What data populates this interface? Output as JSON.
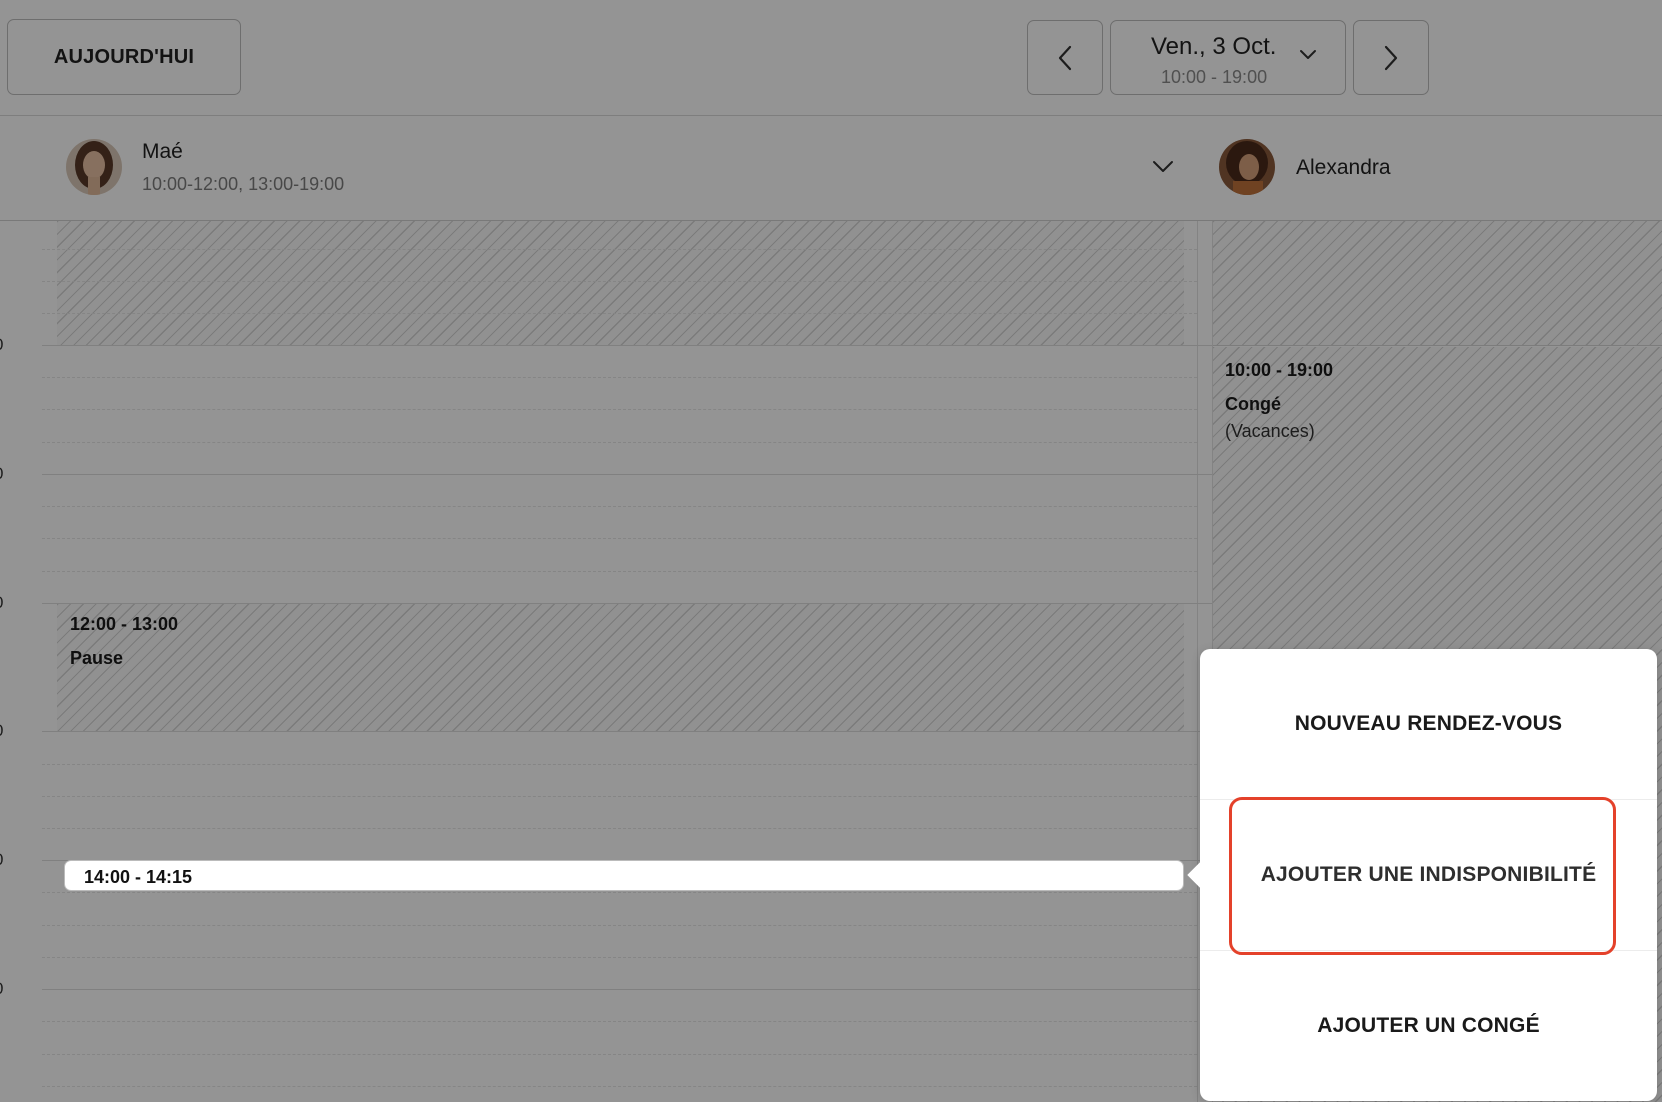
{
  "header": {
    "today_label": "AUJOURD'HUI",
    "date_label": "Ven., 3 Oct.",
    "date_hours": "10:00 - 19:00",
    "prev_icon": "chevron-left-icon",
    "next_icon": "chevron-right-icon",
    "dropdown_icon": "chevron-down-icon"
  },
  "staff": [
    {
      "name": "Maé",
      "hours": "10:00-12:00, 13:00-19:00",
      "avatar": "avatar-photo"
    },
    {
      "name": "Alexandra",
      "hours": "",
      "avatar": "avatar-photo"
    }
  ],
  "time_labels": [
    "0",
    "0",
    "0",
    "0",
    "0",
    "0"
  ],
  "blocks": {
    "mae_break": {
      "time": "12:00 - 13:00",
      "title": "Pause"
    },
    "alexandra_leave": {
      "time": "10:00 - 19:00",
      "title": "Congé",
      "subtitle": "(Vacances)"
    }
  },
  "selection": {
    "time": "14:00 - 14:15"
  },
  "menu": {
    "items": [
      "NOUVEAU RENDEZ-VOUS",
      "AJOUTER UNE INDISPONIBILITÉ",
      "AJOUTER UN CONGÉ"
    ],
    "highlight_color": "#e4412a"
  }
}
